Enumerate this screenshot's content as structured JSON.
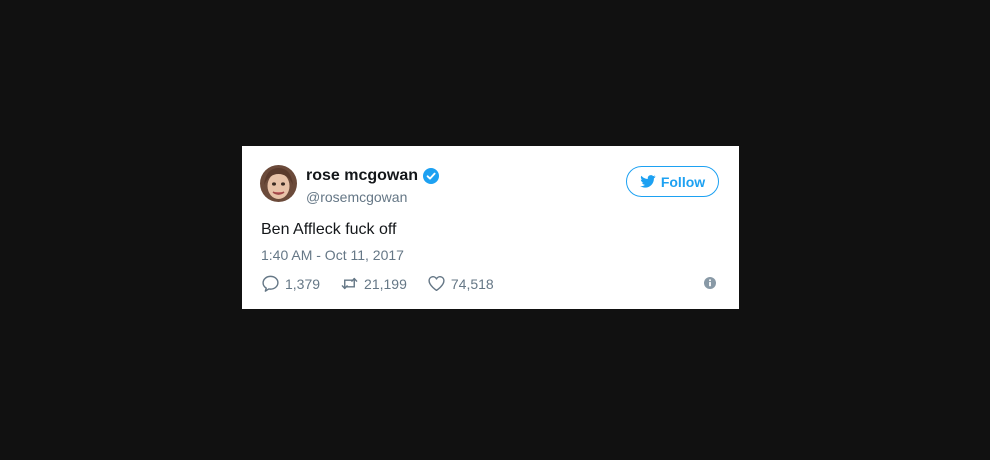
{
  "tweet": {
    "display_name": "rose mcgowan",
    "handle": "@rosemcgowan",
    "verified": true,
    "follow_label": "Follow",
    "text": "Ben Affleck fuck off",
    "timestamp": "1:40 AM - Oct 11, 2017",
    "replies": "1,379",
    "retweets": "21,199",
    "likes": "74,518"
  },
  "icons": {
    "follow": "twitter-bird-icon",
    "verified": "verified-badge-icon",
    "reply": "reply-icon",
    "retweet": "retweet-icon",
    "like": "heart-icon",
    "info": "info-icon"
  },
  "colors": {
    "background": "#111111",
    "card": "#ffffff",
    "accent": "#1da1f2",
    "text": "#14171a",
    "muted": "#657786"
  }
}
